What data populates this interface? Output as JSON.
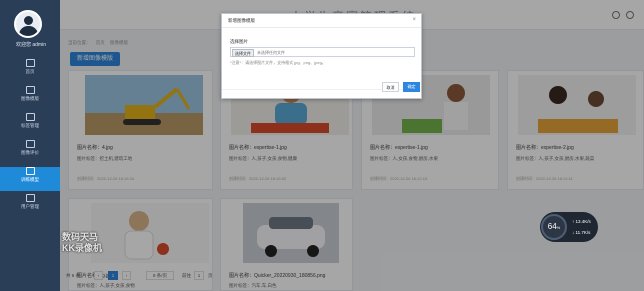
{
  "app": {
    "title": "大学生竞赛管理系统",
    "welcome": "欢迎您 admin"
  },
  "nav": [
    {
      "label": "首页",
      "icon": "home-icon"
    },
    {
      "label": "图像模版",
      "icon": "template-icon"
    },
    {
      "label": "标签管理",
      "icon": "tag-icon"
    },
    {
      "label": "图像评价",
      "icon": "rating-icon"
    },
    {
      "label": "训练模型",
      "icon": "model-icon"
    },
    {
      "label": "用户管理",
      "icon": "users-icon"
    }
  ],
  "breadcrumb": [
    "当前位置：",
    "首页",
    "图像模版"
  ],
  "add_button": "新增图像模版",
  "cards": [
    {
      "name": "图片名称：4.jpg",
      "label": "图片标签：挖土机,建筑工地",
      "time": "创建时间：2022-12-26 16:16:24"
    },
    {
      "name": "图片名称：expertise-1.jpg",
      "label": "图片标签：人,孩子,女孩,食物,健康",
      "time": "创建时间：2022-12-26 16:15:02"
    },
    {
      "name": "图片名称：expertise-1.jpg",
      "label": "图片标签：人,女孩,食物,厨房,水果",
      "time": "创建时间：2022-12-26 16:12:13"
    },
    {
      "name": "图片名称：expertise-2.jpg",
      "label": "图片标签：人,孩子,女孩,厨房,水果,蔬菜",
      "time": "创建时间：2022-12-26 16:12:11"
    },
    {
      "name": "图片名称：g.jpg",
      "label": "图片标签：人,孩子,女孩,食物",
      "time": ""
    },
    {
      "name": "图片名称：Quicker_20220930_180856.png",
      "label": "图片标签：汽车,车,白色",
      "time": ""
    }
  ],
  "modal": {
    "title": "新增图像模版",
    "close": "×",
    "field_label": "选择图片",
    "file_button": "选择文件",
    "file_text": "未选择任何文件",
    "tip": "*注意*：请选择图片文件，支持格式 jpg、png、jpeg。",
    "cancel": "取消",
    "ok": "确定"
  },
  "pager": {
    "total": "共 6 条",
    "current": "1",
    "per_page": "8 条/页",
    "goto_label": "前往",
    "goto_page": "1",
    "page_unit": "页"
  },
  "speed": {
    "value": "64",
    "unit": "%",
    "up": "↑ 13.4K/s",
    "down": "↓ 11.7K/s"
  },
  "watermark": [
    "数码天马",
    "KK录像机"
  ]
}
